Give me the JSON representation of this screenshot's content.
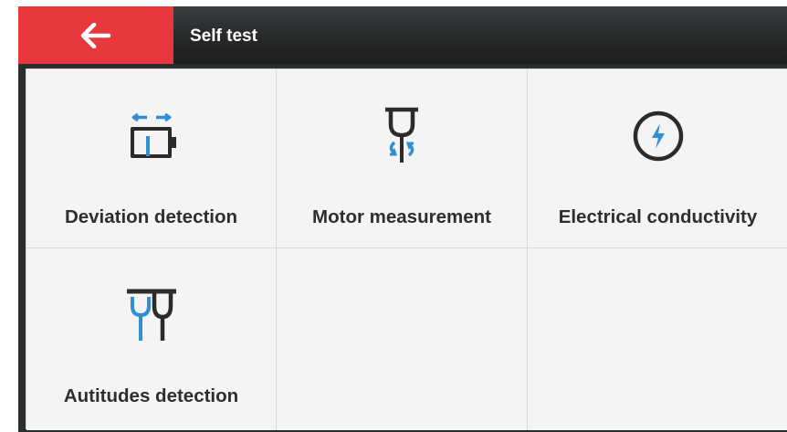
{
  "header": {
    "title": "Self test"
  },
  "icons": {
    "back": "arrow-left-icon"
  },
  "colors": {
    "accent_red": "#e8383e",
    "icon_blue": "#2f8fd6",
    "icon_dark": "#2b2b2b"
  },
  "items": [
    {
      "label": "Deviation detection",
      "icon": "deviation-icon"
    },
    {
      "label": "Motor measurement",
      "icon": "motor-icon"
    },
    {
      "label": "Electrical conductivity",
      "icon": "lightning-circle-icon"
    },
    {
      "label": "Autitudes detection",
      "icon": "probes-icon"
    }
  ]
}
